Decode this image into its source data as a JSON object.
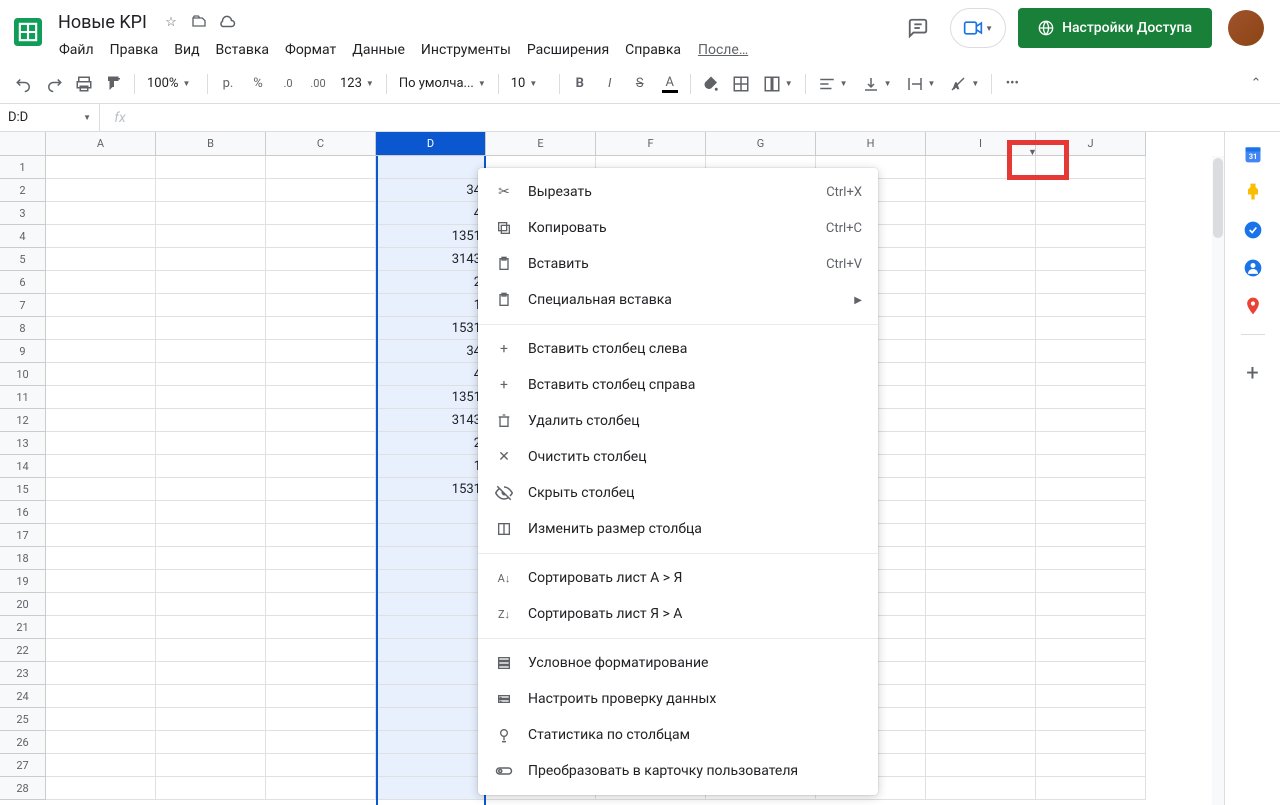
{
  "doc_title": "Новые KPI",
  "last_edit": "После…",
  "menu": [
    "Файл",
    "Правка",
    "Вид",
    "Вставка",
    "Формат",
    "Данные",
    "Инструменты",
    "Расширения",
    "Справка"
  ],
  "share_button": "Настройки Доступа",
  "toolbar": {
    "zoom": "100%",
    "currency_symbol": "р.",
    "percent": "%",
    "decimal_dec": ".0",
    "decimal_inc": ".00",
    "number_format": "123",
    "font": "По умолча...",
    "font_size": "10",
    "more": "•••"
  },
  "name_box": "D:D",
  "fx_label": "fx",
  "columns": [
    "A",
    "B",
    "C",
    "D",
    "E",
    "F",
    "G",
    "H",
    "I",
    "J"
  ],
  "row_count": 28,
  "selected_column": "D",
  "col_d_values": [
    "",
    "34",
    "4",
    "1351",
    "3143",
    "2",
    "1",
    "1531",
    "34",
    "4",
    "1351",
    "3143",
    "2",
    "1",
    "1531",
    "",
    "",
    "",
    "",
    "",
    "",
    "",
    "",
    "",
    "",
    "",
    "",
    ""
  ],
  "ctx": {
    "cut": {
      "label": "Вырезать",
      "shortcut": "Ctrl+X"
    },
    "copy": {
      "label": "Копировать",
      "shortcut": "Ctrl+C"
    },
    "paste": {
      "label": "Вставить",
      "shortcut": "Ctrl+V"
    },
    "paste_special": "Специальная вставка",
    "insert_left": "Вставить столбец слева",
    "insert_right": "Вставить столбец справа",
    "delete_col": "Удалить столбец",
    "clear_col": "Очистить столбец",
    "hide_col": "Скрыть столбец",
    "resize_col": "Изменить размер столбца",
    "sort_az": "Сортировать лист А > Я",
    "sort_za": "Сортировать лист Я > А",
    "cond_format": "Условное форматирование",
    "data_validation": "Настроить проверку данных",
    "col_stats": "Статистика по столбцам",
    "people_chip": "Преобразовать в карточку пользователя"
  }
}
